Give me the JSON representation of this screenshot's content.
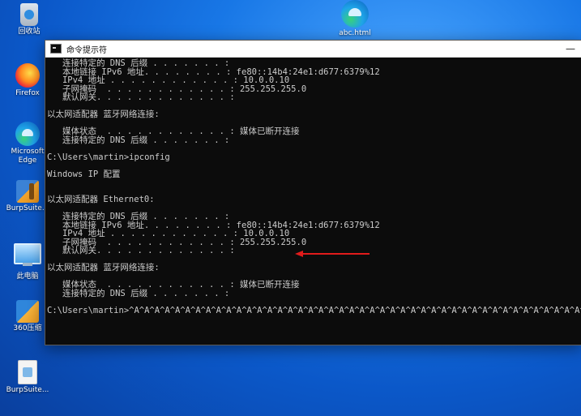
{
  "desktop": {
    "icons": [
      {
        "label": "回收站"
      },
      {
        "label": "Firefox"
      },
      {
        "label": "Microsoft Edge"
      },
      {
        "label": "BurpSuite..."
      },
      {
        "label": "此电脑"
      },
      {
        "label": "360压缩"
      },
      {
        "label": "BurpSuite..."
      },
      {
        "label": "abc.html"
      }
    ]
  },
  "window": {
    "title": "命令提示符",
    "minimize": "—"
  },
  "console": {
    "lines": [
      "   连接特定的 DNS 后缀 . . . . . . . :",
      "   本地链接 IPv6 地址. . . . . . . . : fe80::14b4:24e1:d677:6379%12",
      "   IPv4 地址 . . . . . . . . . . . . : 10.0.0.10",
      "   子网掩码  . . . . . . . . . . . . : 255.255.255.0",
      "   默认网关. . . . . . . . . . . . . :",
      "",
      "以太网适配器 蓝牙网络连接:",
      "",
      "   媒体状态  . . . . . . . . . . . . : 媒体已断开连接",
      "   连接特定的 DNS 后缀 . . . . . . . :",
      "",
      "C:\\Users\\martin>ipconfig",
      "",
      "Windows IP 配置",
      "",
      "",
      "以太网适配器 Ethernet0:",
      "",
      "   连接特定的 DNS 后缀 . . . . . . . :",
      "   本地链接 IPv6 地址. . . . . . . . : fe80::14b4:24e1:d677:6379%12",
      "   IPv4 地址 . . . . . . . . . . . . : 10.0.0.10",
      "   子网掩码  . . . . . . . . . . . . : 255.255.255.0",
      "   默认网关. . . . . . . . . . . . . :",
      "",
      "以太网适配器 蓝牙网络连接:",
      "",
      "   媒体状态  . . . . . . . . . . . . : 媒体已断开连接",
      "   连接特定的 DNS 后缀 . . . . . . . :",
      "",
      "C:\\Users\\martin>^A^A^A^A^A^A^A^A^A^A^A^A^A^A^A^A^A^A^A^A^A^A^A^A^A^A^A^A^A^A^A^A^A^A^A^A^A^A^A^A^A^A^A^A^A"
    ]
  },
  "annotation": {
    "arrow_color": "#e11b1b",
    "arrow_icon": "red-arrow-icon"
  }
}
